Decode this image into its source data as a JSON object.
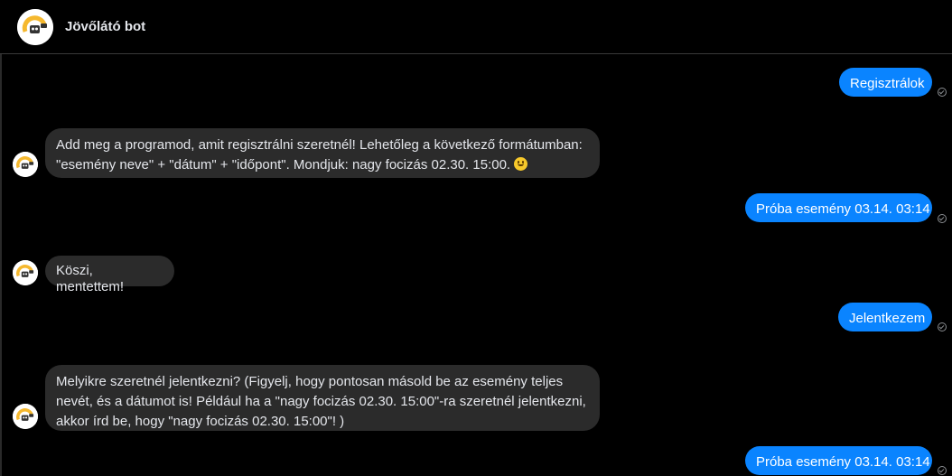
{
  "header": {
    "title": "Jövőlátó bot",
    "avatar_icon": "bot-logo-icon"
  },
  "messages": [
    {
      "sender": "user",
      "text": "Regisztrálok",
      "status_icon": "seen-check-icon"
    },
    {
      "sender": "bot",
      "text": "Add meg a programod, amit regisztrálni szeretnél! Lehetőleg a következő formátumban: \"esemény neve\" + \"dátum\" + \"időpont\". Mondjuk: nagy focizás 02.30. 15:00.",
      "emoji": "smiling-face-icon"
    },
    {
      "sender": "user",
      "text": "Próba esemény 03.14. 03:14",
      "status_icon": "seen-check-icon"
    },
    {
      "sender": "bot",
      "text": "Köszi, mentettem!"
    },
    {
      "sender": "user",
      "text": "Jelentkezem",
      "status_icon": "seen-check-icon"
    },
    {
      "sender": "bot",
      "text": "Melyikre szeretnél jelentkezni? (Figyelj, hogy pontosan másold be az esemény teljes nevét, és a dátumot is! Például ha a \"nagy focizás 02.30. 15:00\"-ra szeretnél jelentkezni, akkor írd be, hogy \"nagy focizás 02.30. 15:00\"! )"
    },
    {
      "sender": "user",
      "text": "Próba esemény 03.14. 03:14",
      "status_icon": "seen-check-icon"
    }
  ],
  "colors": {
    "background": "#000000",
    "outgoing_bubble": "#0a84ff",
    "incoming_bubble": "#2b2b2b",
    "text_light": "#e4e6eb",
    "bot_avatar_accent": "#f5b82e"
  }
}
